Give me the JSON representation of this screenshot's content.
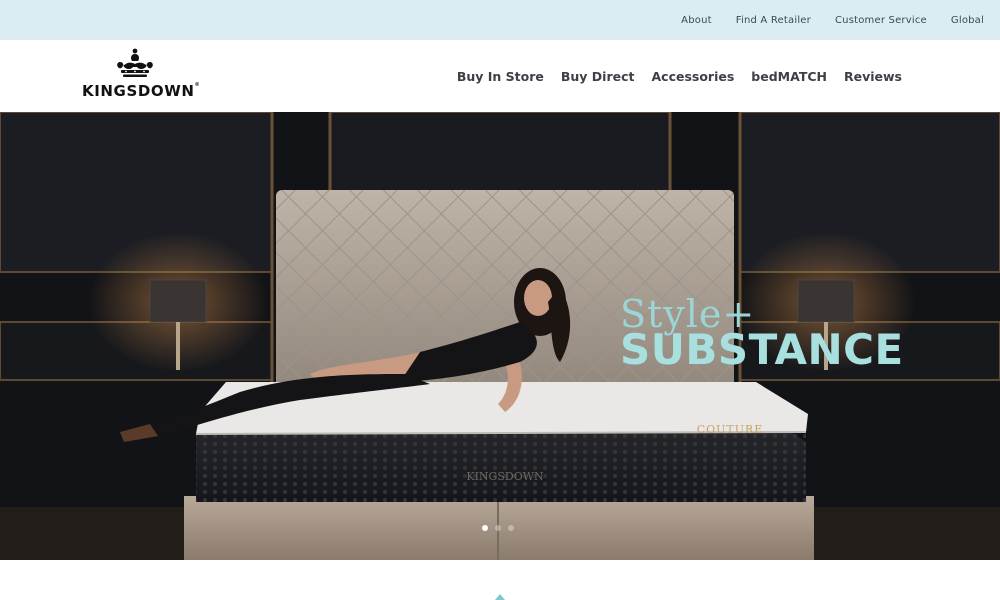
{
  "topbar": {
    "links": [
      "About",
      "Find A Retailer",
      "Customer Service",
      "Global"
    ]
  },
  "brand": {
    "name": "KINGSDOWN",
    "registered": "®"
  },
  "nav": {
    "items": [
      "Buy In Store",
      "Buy Direct",
      "Accessories",
      "bedMATCH",
      "Reviews"
    ]
  },
  "hero": {
    "headline_line1": "Style+",
    "headline_line2": "SUBSTANCE",
    "mattress_label": "COUTURE",
    "mattress_brand": "KINGSDOWN",
    "slide_count": 3,
    "active_slide": 1
  },
  "colors": {
    "topbar_bg": "#dcedf2",
    "accent_teal": "#a8e0e0",
    "nav_text": "#3d4147"
  }
}
